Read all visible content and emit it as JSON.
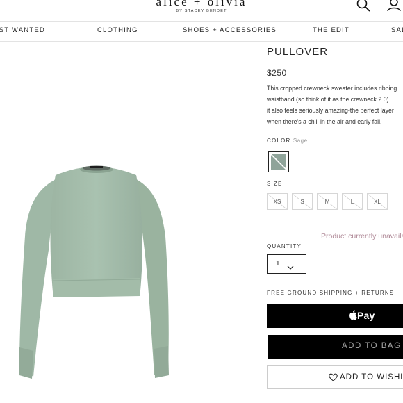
{
  "header": {
    "logo_main": "alice + olivia",
    "logo_sub": "BY STACEY BENDET",
    "icons": [
      "search-icon",
      "account-icon"
    ]
  },
  "nav": {
    "items": [
      {
        "label": "MOST WANTED"
      },
      {
        "label": "CLOTHING"
      },
      {
        "label": "SHOES + ACCESSORIES"
      },
      {
        "label": "THE EDIT"
      },
      {
        "label": "SALE"
      }
    ]
  },
  "product": {
    "title": "PULLOVER",
    "price": "$250",
    "description": [
      "This cropped crewneck sweater includes ribbing",
      "waistband (so think of it as the crewneck 2.0). I",
      "it also feels seriously amazing-the perfect layer",
      "when there's a chill in the air and early fall."
    ],
    "color_label": "COLOR",
    "color_value": "Sage",
    "swatch_color": "#8fa49a",
    "size_label": "SIZE",
    "sizes": [
      "XS",
      "S",
      "M",
      "L",
      "XL"
    ],
    "unavailable_text": "Product currently unavailable",
    "quantity_label": "QUANTITY",
    "quantity_value": "1",
    "shipping_text": "FREE GROUND SHIPPING + RETURNS",
    "applepay_label": "Pay",
    "add_to_bag_label": "ADD TO BAG",
    "wishlist_label": "ADD TO WISHLIST",
    "sweater_color": "#a7c0ae"
  }
}
